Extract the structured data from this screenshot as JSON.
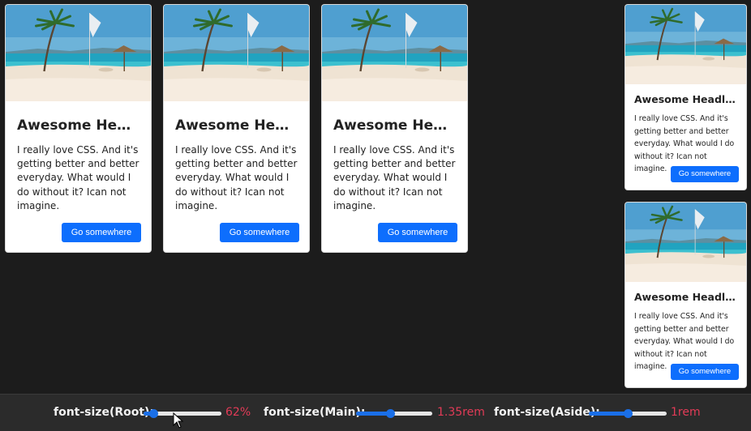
{
  "cards": {
    "headline": "Awesome Headline for the Card",
    "text": "I really love CSS. And it's getting better and better everyday. What would I do without it? Ican not imagine.",
    "button_label": "Go somewhere"
  },
  "controls": {
    "root": {
      "label": "font-size(Root):",
      "value": "62%",
      "level": 0.12
    },
    "main": {
      "label": "font-size(Main):",
      "value": "1.35rem",
      "level": 0.45
    },
    "aside": {
      "label": "font-size(Aside):",
      "value": "1rem",
      "level": 0.5
    }
  },
  "colors": {
    "accent": "#0d6efd",
    "value_text": "#e23b57",
    "background": "#1c1c1c"
  }
}
